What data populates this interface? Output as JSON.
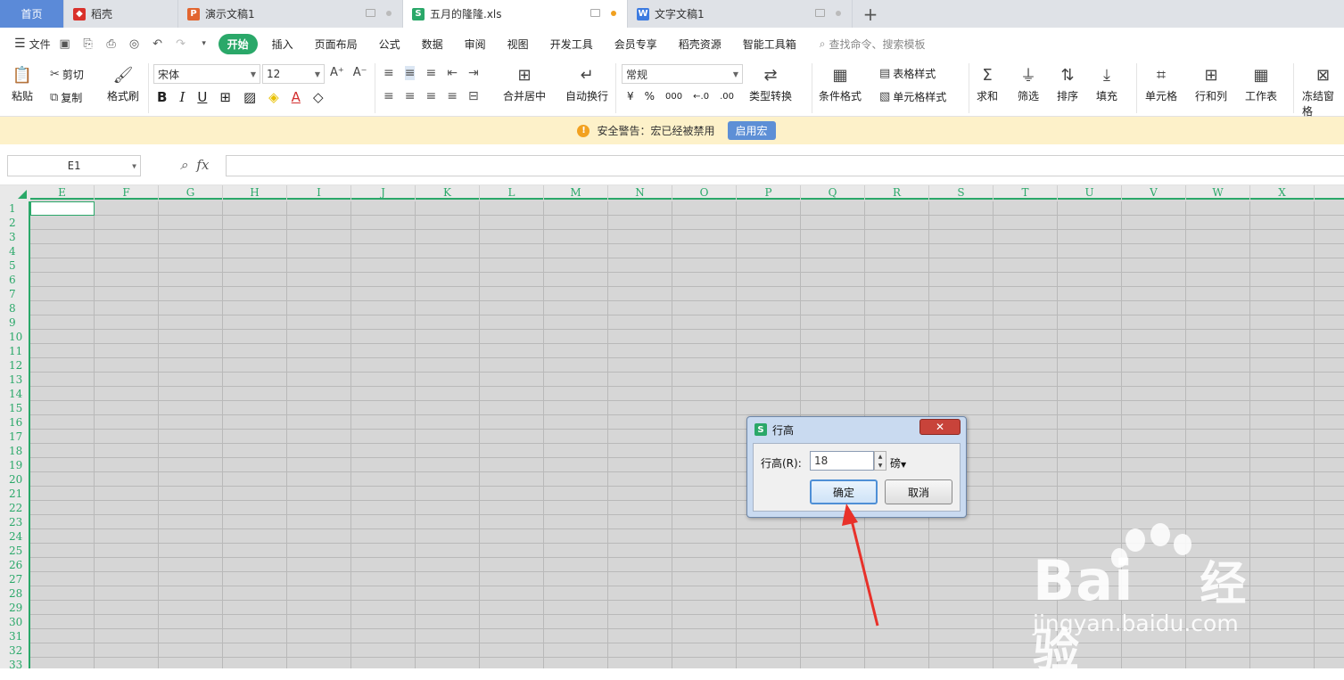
{
  "tabs": [
    {
      "label": "首页",
      "icon": "home-icon"
    },
    {
      "label": "稻壳",
      "icon": "daoke-logo-icon",
      "color": "#d9312b"
    },
    {
      "label": "演示文稿1",
      "icon": "presentation-file-icon",
      "color": "#e2652f"
    },
    {
      "label": "五月的隆隆.xls",
      "icon": "spreadsheet-file-icon",
      "color": "#2aa869",
      "active": true
    },
    {
      "label": "文字文稿1",
      "icon": "document-file-icon",
      "color": "#3c7be0"
    }
  ],
  "menu": {
    "file_label": "文件",
    "start_label": "开始",
    "items": [
      "插入",
      "页面布局",
      "公式",
      "数据",
      "审阅",
      "视图",
      "开发工具",
      "会员专享",
      "稻壳资源",
      "智能工具箱"
    ],
    "search_placeholder": "查找命令、搜索模板"
  },
  "ribbon": {
    "paste": "粘贴",
    "cut": "剪切",
    "copy": "复制",
    "format_painter": "格式刷",
    "font_name": "宋体",
    "font_size": "12",
    "merge_center": "合并居中",
    "wrap_text": "自动换行",
    "number_format": "常规",
    "currency": "¥",
    "percent": "%",
    "thousands": "000",
    "type_convert": "类型转换",
    "conditional_format": "条件格式",
    "table_style": "表格样式",
    "cell_style": "单元格样式",
    "sum": "求和",
    "filter": "筛选",
    "sort": "排序",
    "fill": "填充",
    "cell": "单元格",
    "row_col": "行和列",
    "worksheet": "工作表",
    "freeze": "冻结窗格"
  },
  "security": {
    "message": "安全警告：宏已经被禁用",
    "button": "启用宏"
  },
  "formula_bar": {
    "cell_ref": "E1",
    "fx": "fx"
  },
  "grid": {
    "columns": [
      "E",
      "F",
      "G",
      "H",
      "I",
      "J",
      "K",
      "L",
      "M",
      "N",
      "O",
      "P",
      "Q",
      "R",
      "S",
      "T",
      "U",
      "V",
      "W",
      "X"
    ],
    "rows": [
      "1",
      "2",
      "3",
      "4",
      "5",
      "6",
      "7",
      "8",
      "9",
      "10",
      "11",
      "12",
      "13",
      "14",
      "15",
      "16",
      "17",
      "18",
      "19",
      "20",
      "21",
      "22",
      "23",
      "24",
      "25",
      "26",
      "27",
      "28",
      "29",
      "30",
      "31",
      "32",
      "33"
    ]
  },
  "dialog": {
    "title": "行高",
    "label": "行高(R):",
    "value": "18",
    "unit": "磅",
    "ok": "确定",
    "cancel": "取消"
  },
  "watermark": {
    "brand": "Bai",
    "brand_suffix": "经验",
    "url": "jingyan.baidu.com"
  }
}
